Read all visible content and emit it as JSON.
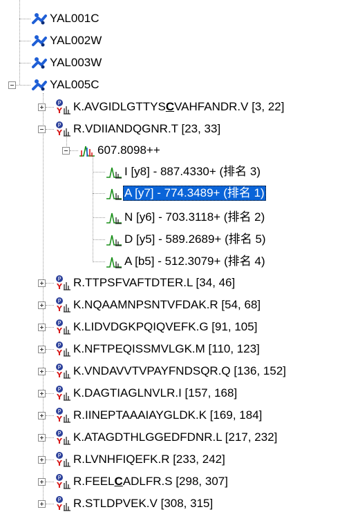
{
  "proteins": [
    {
      "label": "YAL001C"
    },
    {
      "label": "YAL002W"
    },
    {
      "label": "YAL003W"
    },
    {
      "label": "YAL005C"
    }
  ],
  "peptides": [
    {
      "pre": "K.AVGIDLGTTYS",
      "bold": "C",
      "post": "VAHFANDR.V [3, 22]"
    },
    {
      "pre": "R.VDIIANDQGNR.T [23, 33]",
      "bold": "",
      "post": ""
    },
    {
      "pre": "R.TTPSFVAFTDTER.L [34, 46]",
      "bold": "",
      "post": ""
    },
    {
      "pre": "K.NQAAMNPSNTVFDAK.R [54, 68]",
      "bold": "",
      "post": ""
    },
    {
      "pre": "K.LIDVDGKPQIQVEFK.G [91, 105]",
      "bold": "",
      "post": ""
    },
    {
      "pre": "K.NFTPEQISSMVLGK.M [110, 123]",
      "bold": "",
      "post": ""
    },
    {
      "pre": "K.VNDAVVTVPAYFNDSQR.Q [136, 152]",
      "bold": "",
      "post": ""
    },
    {
      "pre": "K.DAGTIAGLNVLR.I [157, 168]",
      "bold": "",
      "post": ""
    },
    {
      "pre": "R.IINEPTAAAIAYGLDK.K [169, 184]",
      "bold": "",
      "post": ""
    },
    {
      "pre": "K.ATAGDTHLGGEDFDNR.L [217, 232]",
      "bold": "",
      "post": ""
    },
    {
      "pre": "R.LVNHFIQEFK.R [233, 242]",
      "bold": "",
      "post": ""
    },
    {
      "pre": "R.FEEL",
      "bold": "C",
      "post": "ADLFR.S [298, 307]"
    },
    {
      "pre": "R.STLDPVEK.V [308, 315]",
      "bold": "",
      "post": ""
    }
  ],
  "precursor": {
    "label": "607.8098++"
  },
  "fragments": [
    {
      "label": "I [y8] - 887.4330+ (排名 3)"
    },
    {
      "label": "A [y7] - 774.3489+ (排名 1)"
    },
    {
      "label": "N [y6] - 703.3118+ (排名 2)"
    },
    {
      "label": "D [y5] - 589.2689+ (排名 5)"
    },
    {
      "label": "A [b5] - 512.3079+ (排名 4)"
    }
  ],
  "colors": {
    "selection": "#0a64d8",
    "protein_icon": "#1f5fd6",
    "peptide_icon": "#2a3f9a",
    "peptide_y": "#d81b1b"
  }
}
